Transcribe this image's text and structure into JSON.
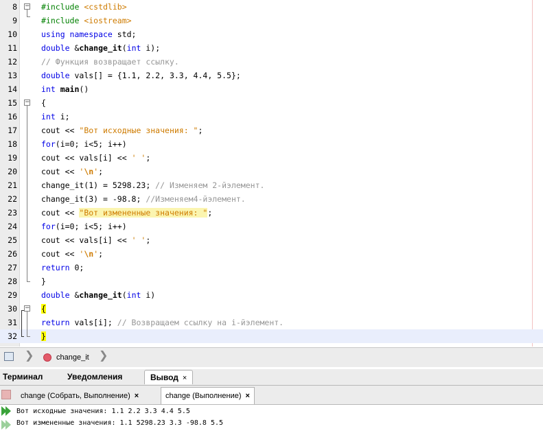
{
  "editor": {
    "lines": [
      {
        "num": "8",
        "tokens": [
          {
            "t": "#include ",
            "c": "pp"
          },
          {
            "t": "<cstdlib>",
            "c": "str"
          }
        ]
      },
      {
        "num": "9",
        "tokens": [
          {
            "t": "#include ",
            "c": "pp"
          },
          {
            "t": "<iostream>",
            "c": "str"
          }
        ]
      },
      {
        "num": "10",
        "tokens": [
          {
            "t": "using namespace ",
            "c": "kw"
          },
          {
            "t": "std;",
            "c": ""
          }
        ]
      },
      {
        "num": "11",
        "tokens": [
          {
            "t": "double ",
            "c": "kw"
          },
          {
            "t": "&",
            "c": ""
          },
          {
            "t": "change_it",
            "c": "fn"
          },
          {
            "t": "(",
            "c": ""
          },
          {
            "t": "int",
            "c": "kw"
          },
          {
            "t": " i);",
            "c": ""
          }
        ]
      },
      {
        "num": "12",
        "tokens": [
          {
            "t": "// Функция возвращает ссылку.",
            "c": "cm"
          }
        ]
      },
      {
        "num": "13",
        "tokens": [
          {
            "t": "double ",
            "c": "kw"
          },
          {
            "t": "vals[] = {1.1, 2.2, 3.3, 4.4, 5.5};",
            "c": ""
          }
        ]
      },
      {
        "num": "14",
        "tokens": [
          {
            "t": "int ",
            "c": "kw"
          },
          {
            "t": "main",
            "c": "fn"
          },
          {
            "t": "()",
            "c": ""
          }
        ]
      },
      {
        "num": "15",
        "tokens": [
          {
            "t": "{",
            "c": ""
          }
        ]
      },
      {
        "num": "16",
        "tokens": [
          {
            "t": "int ",
            "c": "kw"
          },
          {
            "t": "i;",
            "c": ""
          }
        ]
      },
      {
        "num": "17",
        "tokens": [
          {
            "t": "cout << ",
            "c": ""
          },
          {
            "t": "\"Вот исходные значения: \"",
            "c": "str"
          },
          {
            "t": ";",
            "c": ""
          }
        ]
      },
      {
        "num": "18",
        "tokens": [
          {
            "t": "for",
            "c": "kw"
          },
          {
            "t": "(i=0; i<5; i++)",
            "c": ""
          }
        ]
      },
      {
        "num": "19",
        "tokens": [
          {
            "t": "cout << vals[i] << ",
            "c": ""
          },
          {
            "t": "' '",
            "c": "str"
          },
          {
            "t": ";",
            "c": ""
          }
        ]
      },
      {
        "num": "20",
        "tokens": [
          {
            "t": "cout << ",
            "c": ""
          },
          {
            "t": "'",
            "c": "str"
          },
          {
            "t": "\\n",
            "c": "esc"
          },
          {
            "t": "'",
            "c": "str"
          },
          {
            "t": ";",
            "c": ""
          }
        ]
      },
      {
        "num": "21",
        "tokens": [
          {
            "t": "change_it(1) = 5298.23; ",
            "c": ""
          },
          {
            "t": "// Изменяем 2-йэлемент.",
            "c": "cm"
          }
        ]
      },
      {
        "num": "22",
        "tokens": [
          {
            "t": "change_it(3) = -98.8; ",
            "c": ""
          },
          {
            "t": "//Изменяем4-йэлемент.",
            "c": "cm"
          }
        ]
      },
      {
        "num": "23",
        "tokens": [
          {
            "t": "cout << ",
            "c": ""
          },
          {
            "t": "\"Вот измененные значения: \"",
            "c": "str hl"
          },
          {
            "t": ";",
            "c": ""
          }
        ]
      },
      {
        "num": "24",
        "tokens": [
          {
            "t": "for",
            "c": "kw"
          },
          {
            "t": "(i=0; i<5; i++)",
            "c": ""
          }
        ]
      },
      {
        "num": "25",
        "tokens": [
          {
            "t": "cout << vals[i] << ",
            "c": ""
          },
          {
            "t": "' '",
            "c": "str"
          },
          {
            "t": ";",
            "c": ""
          }
        ]
      },
      {
        "num": "26",
        "tokens": [
          {
            "t": "cout << ",
            "c": ""
          },
          {
            "t": "'",
            "c": "str"
          },
          {
            "t": "\\n",
            "c": "esc"
          },
          {
            "t": "'",
            "c": "str"
          },
          {
            "t": ";",
            "c": ""
          }
        ]
      },
      {
        "num": "27",
        "tokens": [
          {
            "t": "return ",
            "c": "kw"
          },
          {
            "t": "0;",
            "c": ""
          }
        ]
      },
      {
        "num": "28",
        "tokens": [
          {
            "t": "}",
            "c": ""
          }
        ]
      },
      {
        "num": "29",
        "tokens": [
          {
            "t": "double ",
            "c": "kw"
          },
          {
            "t": "&",
            "c": ""
          },
          {
            "t": "change_it",
            "c": "fn"
          },
          {
            "t": "(",
            "c": ""
          },
          {
            "t": "int",
            "c": "kw"
          },
          {
            "t": " i)",
            "c": ""
          }
        ]
      },
      {
        "num": "30",
        "tokens": [
          {
            "t": "{",
            "c": "hlb"
          }
        ]
      },
      {
        "num": "31",
        "tokens": [
          {
            "t": "return ",
            "c": "kw"
          },
          {
            "t": "vals[i]; ",
            "c": ""
          },
          {
            "t": "// Возвращаем ссылку на i-йэлемент.",
            "c": "cm"
          }
        ]
      },
      {
        "num": "32",
        "tokens": [
          {
            "t": "}",
            "c": "hlb"
          }
        ]
      }
    ],
    "current_line": "32"
  },
  "navbar": {
    "function_label": "change_it",
    "separator": "❯"
  },
  "bottom_tabs": [
    {
      "label": "Терминал",
      "active": false
    },
    {
      "label": "Уведомления",
      "active": false
    },
    {
      "label": "Вывод",
      "active": true,
      "close": "×"
    }
  ],
  "output_tabs": [
    {
      "label": "change (Собрать, Выполнение)",
      "close": "×",
      "active": false
    },
    {
      "label": "change (Выполнение)",
      "close": "×",
      "active": true
    }
  ],
  "output": {
    "lines": [
      "Вот исходные значения: 1.1 2.2 3.3 4.4 5.5",
      "Вот измененные значения: 1.1 5298.23 3.3 -98.8 5.5"
    ]
  },
  "colors": {
    "keyword": "#0000e6",
    "preprocessor": "#008000",
    "string": "#ce7b00",
    "comment": "#969696",
    "highlight": "#fbf5b0",
    "brace_match": "#ffff00"
  }
}
